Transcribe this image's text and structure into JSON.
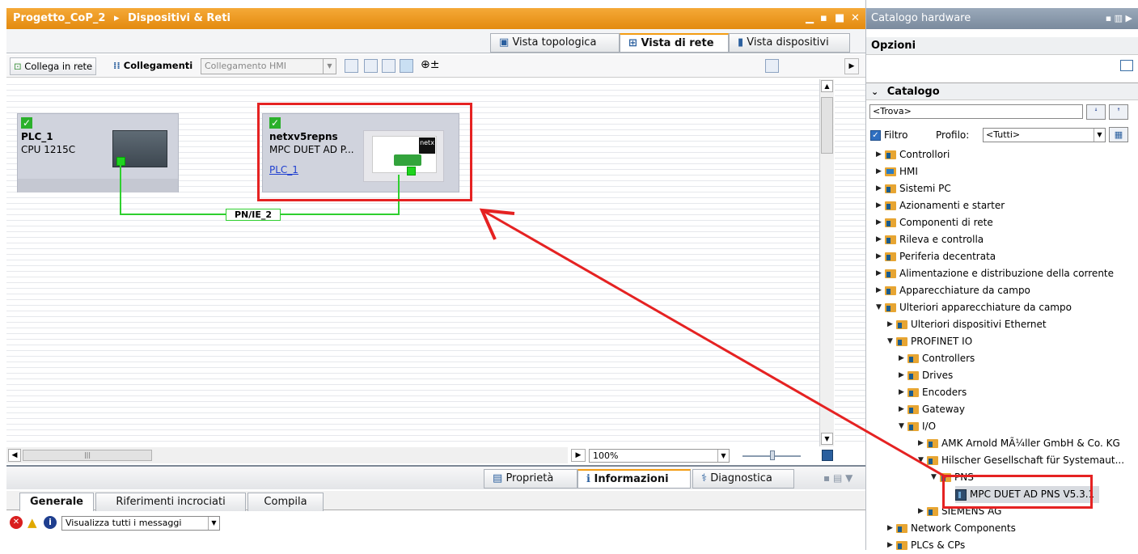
{
  "editor": {
    "breadcrumb_project": "Progetto_CoP_2",
    "breadcrumb_sep": "▸",
    "breadcrumb_page": "Dispositivi & Reti",
    "view_tabs": [
      "Vista topologica",
      "Vista di rete",
      "Vista dispositivi"
    ],
    "active_view": "Vista di rete"
  },
  "toolbar": {
    "connect_label": "Collega in rete",
    "connections_label": "Collegamenti",
    "connection_type": "Collegamento HMI",
    "zoom_value": "100%"
  },
  "devices": [
    {
      "name": "PLC_1",
      "type": "CPU 1215C"
    },
    {
      "name": "netxv5repns",
      "type": "MPC DUET AD P...",
      "link": "PLC_1",
      "logo_text": "netx"
    }
  ],
  "network_label": "PN/IE_2",
  "inspector": {
    "tabs": [
      "Proprietà",
      "Informazioni",
      "Diagnostica"
    ],
    "active_tab": "Informazioni",
    "subtabs": [
      "Generale",
      "Riferimenti incrociati",
      "Compila"
    ],
    "filter_value": "Visualizza tutti i messaggi"
  },
  "catalog": {
    "title": "Catalogo hardware",
    "options_label": "Opzioni",
    "section_label": "Catalogo",
    "search_value": "<Trova>",
    "filter_label": "Filtro",
    "profile_label": "Profilo:",
    "profile_value": "<Tutti>",
    "tree": [
      {
        "label": "Controllori",
        "depth": 0,
        "open": false
      },
      {
        "label": "HMI",
        "depth": 0,
        "open": false
      },
      {
        "label": "Sistemi PC",
        "depth": 0,
        "open": false
      },
      {
        "label": "Azionamenti e starter",
        "depth": 0,
        "open": false
      },
      {
        "label": "Componenti di rete",
        "depth": 0,
        "open": false
      },
      {
        "label": "Rileva e controlla",
        "depth": 0,
        "open": false
      },
      {
        "label": "Periferia decentrata",
        "depth": 0,
        "open": false
      },
      {
        "label": "Alimentazione e distribuzione della corrente",
        "depth": 0,
        "open": false
      },
      {
        "label": "Apparecchiature da campo",
        "depth": 0,
        "open": false
      },
      {
        "label": "Ulteriori apparecchiature da campo",
        "depth": 0,
        "open": true
      },
      {
        "label": "Ulteriori dispositivi Ethernet",
        "depth": 1,
        "open": false
      },
      {
        "label": "PROFINET IO",
        "depth": 1,
        "open": true
      },
      {
        "label": "Controllers",
        "depth": 2,
        "open": false
      },
      {
        "label": "Drives",
        "depth": 2,
        "open": false
      },
      {
        "label": "Encoders",
        "depth": 2,
        "open": false
      },
      {
        "label": "Gateway",
        "depth": 2,
        "open": false
      },
      {
        "label": "I/O",
        "depth": 2,
        "open": true
      },
      {
        "label": "AMK Arnold MÃ¼ller GmbH & Co. KG",
        "depth": 3,
        "open": false
      },
      {
        "label": "Hilscher Gesellschaft für Systemaut...",
        "depth": 3,
        "open": true
      },
      {
        "label": "PNS",
        "depth": 4,
        "open": true
      },
      {
        "label": "MPC DUET AD PNS V5.3.1",
        "depth": 5,
        "open": null
      },
      {
        "label": "SIEMENS AG",
        "depth": 3,
        "open": false
      },
      {
        "label": "Network Components",
        "depth": 1,
        "open": false
      },
      {
        "label": "PLCs & CPs",
        "depth": 1,
        "open": false
      }
    ]
  },
  "colors": {
    "title_orange": "#e38a0f",
    "highlight_red": "#e52222",
    "port_green": "#1fd41f"
  }
}
